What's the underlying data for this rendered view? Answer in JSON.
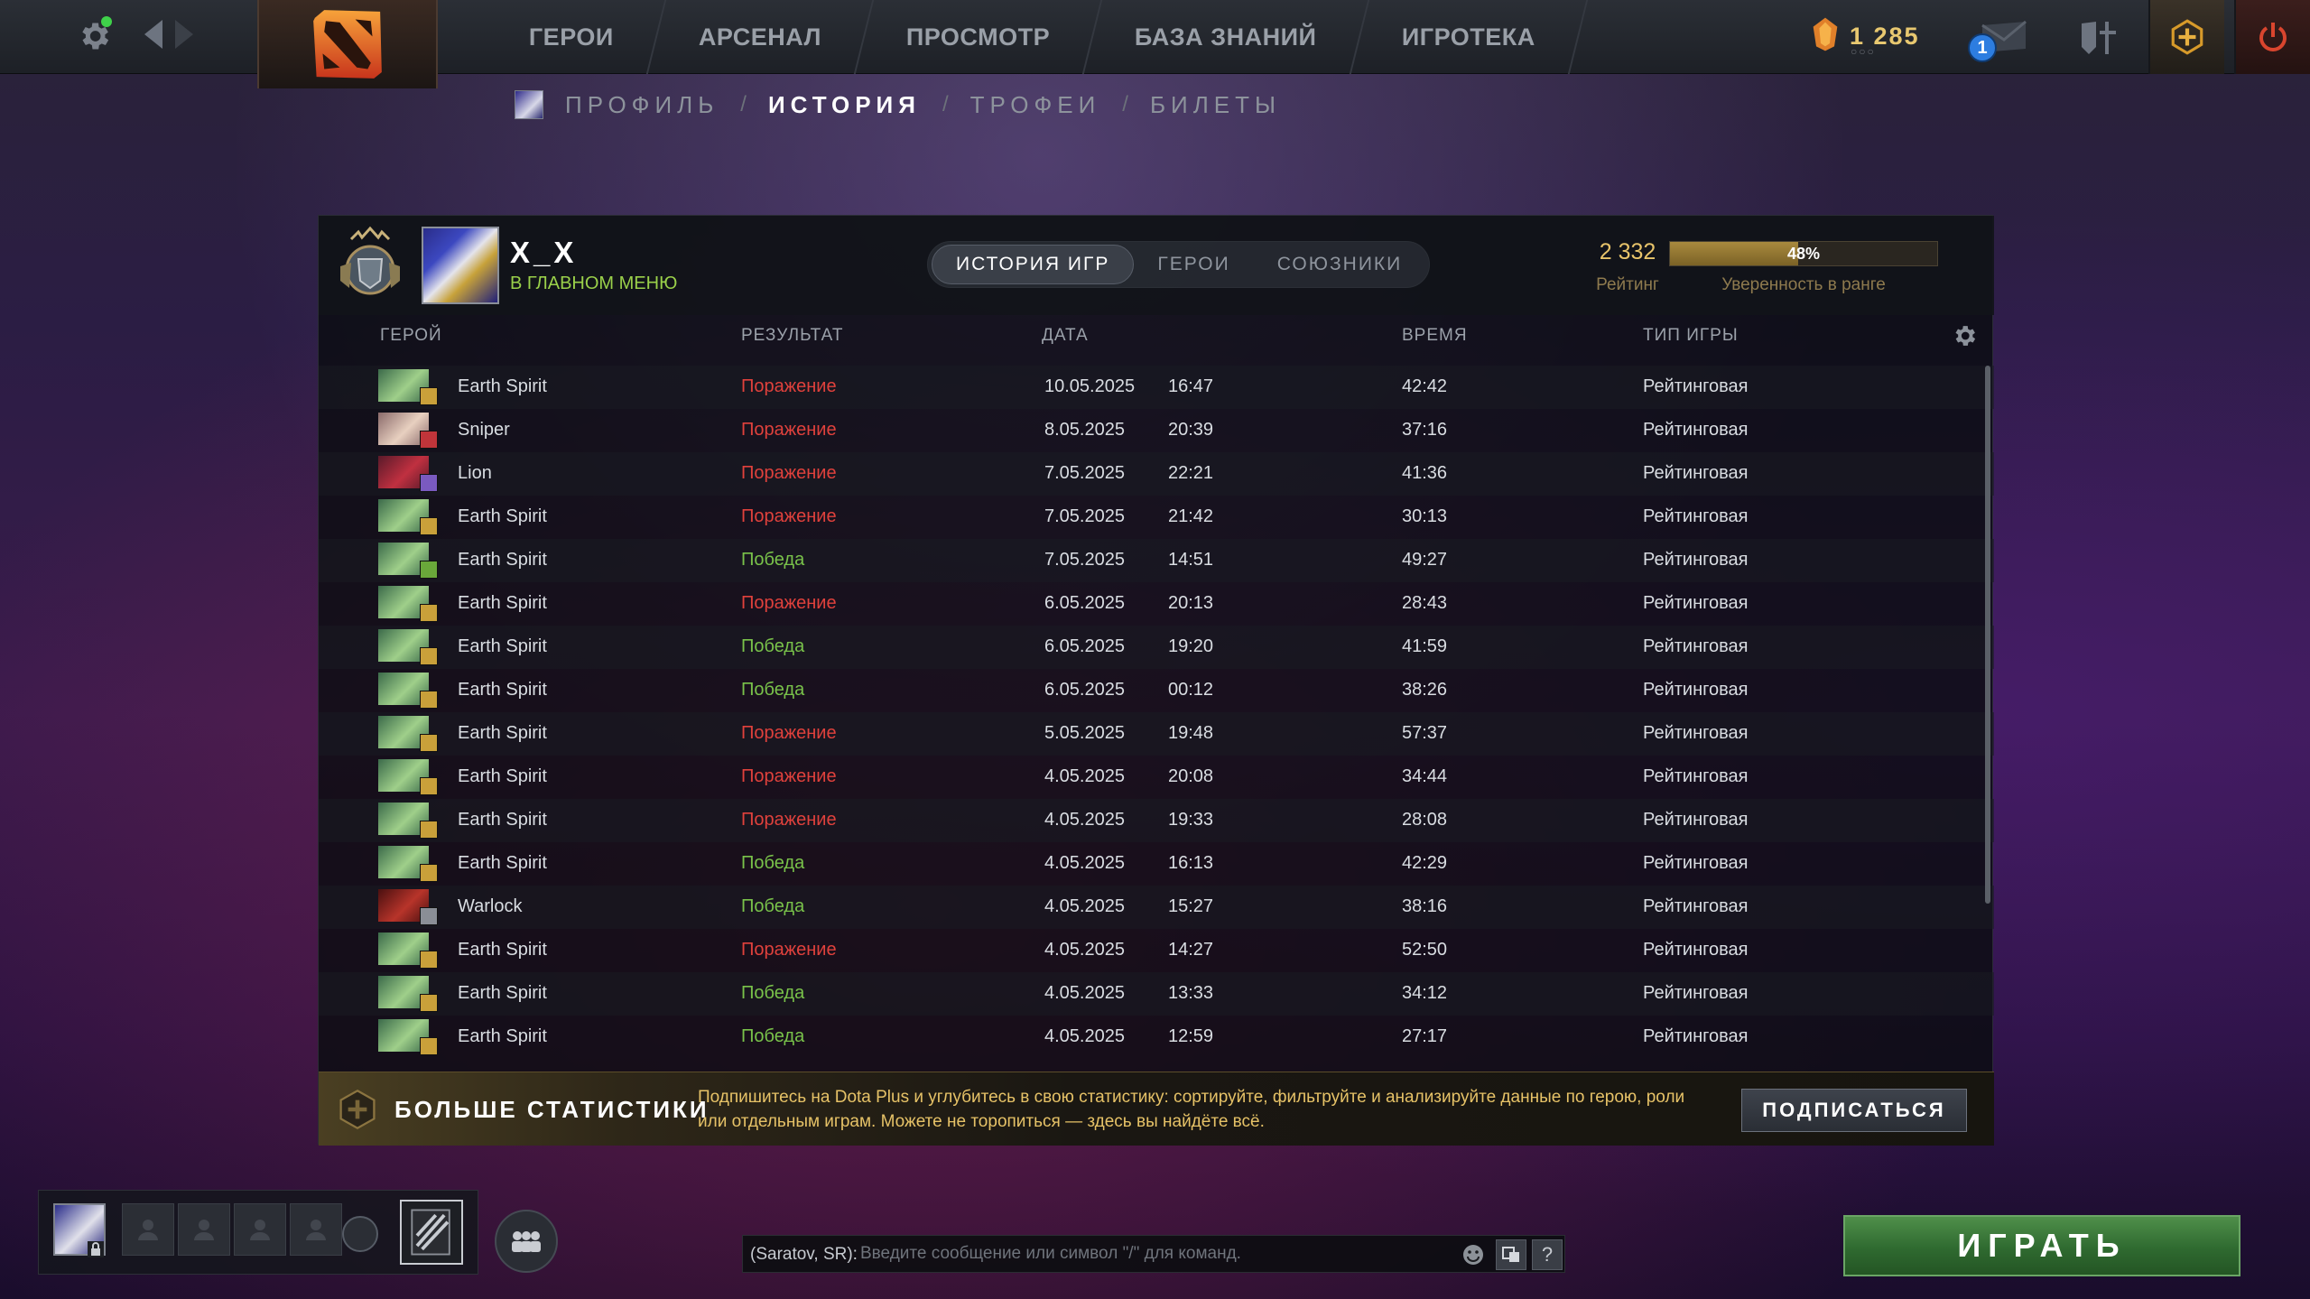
{
  "topbar": {
    "nav": [
      "ГЕРОИ",
      "АРСЕНАЛ",
      "ПРОСМОТР",
      "БАЗА ЗНАНИЙ",
      "ИГРОТЕКА"
    ],
    "currency_value": "1 285",
    "currency_dots": "○○○",
    "mail_badge": "1"
  },
  "breadcrumb": {
    "items": [
      "ПРОФИЛЬ",
      "ИСТОРИЯ",
      "ТРОФЕИ",
      "БИЛЕТЫ"
    ],
    "separator": "/",
    "active_index": 1
  },
  "profile": {
    "name": "X_X",
    "status": "В ГЛАВНОМ МЕНЮ",
    "tabs": [
      "ИСТОРИЯ ИГР",
      "ГЕРОИ",
      "СОЮЗНИКИ"
    ],
    "active_tab": 0,
    "rating_value": "2 332",
    "rating_label": "Рейтинг",
    "confidence_percent": 48,
    "confidence_text": "48%",
    "confidence_label": "Уверенность в ранге"
  },
  "table": {
    "columns": [
      "ГЕРОЙ",
      "РЕЗУЛЬТАТ",
      "ДАТА",
      "ВРЕМЯ",
      "ТИП ИГРЫ"
    ],
    "rows": [
      {
        "hero": "Earth Spirit",
        "result": "Поражение",
        "win": false,
        "date": "10.05.2025",
        "time": "16:47",
        "duration": "42:42",
        "type": "Рейтинговая",
        "badge": "gold"
      },
      {
        "hero": "Sniper",
        "result": "Поражение",
        "win": false,
        "date": "8.05.2025",
        "time": "20:39",
        "duration": "37:16",
        "type": "Рейтинговая",
        "badge": "red"
      },
      {
        "hero": "Lion",
        "result": "Поражение",
        "win": false,
        "date": "7.05.2025",
        "time": "22:21",
        "duration": "41:36",
        "type": "Рейтинговая",
        "badge": "purple"
      },
      {
        "hero": "Earth Spirit",
        "result": "Поражение",
        "win": false,
        "date": "7.05.2025",
        "time": "21:42",
        "duration": "30:13",
        "type": "Рейтинговая",
        "badge": "gold"
      },
      {
        "hero": "Earth Spirit",
        "result": "Победа",
        "win": true,
        "date": "7.05.2025",
        "time": "14:51",
        "duration": "49:27",
        "type": "Рейтинговая",
        "badge": "green"
      },
      {
        "hero": "Earth Spirit",
        "result": "Поражение",
        "win": false,
        "date": "6.05.2025",
        "time": "20:13",
        "duration": "28:43",
        "type": "Рейтинговая",
        "badge": "gold"
      },
      {
        "hero": "Earth Spirit",
        "result": "Победа",
        "win": true,
        "date": "6.05.2025",
        "time": "19:20",
        "duration": "41:59",
        "type": "Рейтинговая",
        "badge": "gold"
      },
      {
        "hero": "Earth Spirit",
        "result": "Победа",
        "win": true,
        "date": "6.05.2025",
        "time": "00:12",
        "duration": "38:26",
        "type": "Рейтинговая",
        "badge": "gold"
      },
      {
        "hero": "Earth Spirit",
        "result": "Поражение",
        "win": false,
        "date": "5.05.2025",
        "time": "19:48",
        "duration": "57:37",
        "type": "Рейтинговая",
        "badge": "gold"
      },
      {
        "hero": "Earth Spirit",
        "result": "Поражение",
        "win": false,
        "date": "4.05.2025",
        "time": "20:08",
        "duration": "34:44",
        "type": "Рейтинговая",
        "badge": "gold"
      },
      {
        "hero": "Earth Spirit",
        "result": "Поражение",
        "win": false,
        "date": "4.05.2025",
        "time": "19:33",
        "duration": "28:08",
        "type": "Рейтинговая",
        "badge": "gold"
      },
      {
        "hero": "Earth Spirit",
        "result": "Победа",
        "win": true,
        "date": "4.05.2025",
        "time": "16:13",
        "duration": "42:29",
        "type": "Рейтинговая",
        "badge": "gold"
      },
      {
        "hero": "Warlock",
        "result": "Победа",
        "win": true,
        "date": "4.05.2025",
        "time": "15:27",
        "duration": "38:16",
        "type": "Рейтинговая",
        "badge": "grey"
      },
      {
        "hero": "Earth Spirit",
        "result": "Поражение",
        "win": false,
        "date": "4.05.2025",
        "time": "14:27",
        "duration": "52:50",
        "type": "Рейтинговая",
        "badge": "gold"
      },
      {
        "hero": "Earth Spirit",
        "result": "Победа",
        "win": true,
        "date": "4.05.2025",
        "time": "13:33",
        "duration": "34:12",
        "type": "Рейтинговая",
        "badge": "gold"
      },
      {
        "hero": "Earth Spirit",
        "result": "Победа",
        "win": true,
        "date": "4.05.2025",
        "time": "12:59",
        "duration": "27:17",
        "type": "Рейтинговая",
        "badge": "gold"
      }
    ]
  },
  "plus_banner": {
    "title": "БОЛЬШЕ СТАТИСТИКИ",
    "text": "Подпишитесь на Dota Plus и углубитесь в свою статистику: сортируйте, фильтруйте и анализируйте данные по герою, роли или отдельным играм. Можете не торопиться — здесь вы найдёте всё.",
    "button": "ПОДПИСАТЬСЯ"
  },
  "chat": {
    "prefix": "(Saratov, SR):",
    "placeholder": "Введите сообщение или символ \"/\" для команд.",
    "help": "?"
  },
  "play_button": "ИГРАТЬ",
  "colors": {
    "win": "#79c24a",
    "loss": "#e0413c",
    "gold": "#e7c36a",
    "play_green": "#3f7d3c"
  }
}
